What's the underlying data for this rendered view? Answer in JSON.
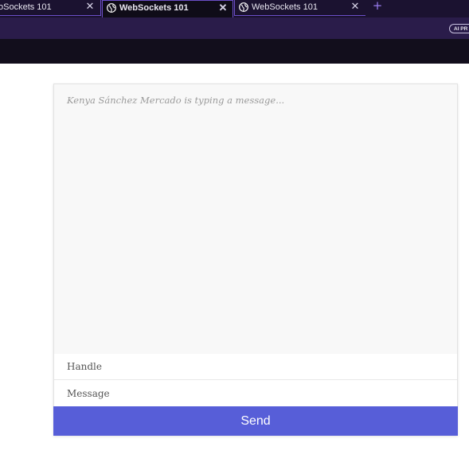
{
  "browser": {
    "tabs": [
      {
        "title": "oSockets 101",
        "close_icon": "close-icon"
      },
      {
        "title": "WebSockets 101",
        "icon": "globe-icon",
        "close_icon": "close-icon",
        "active": true
      },
      {
        "title": "WebSockets 101",
        "icon": "globe-icon",
        "close_icon": "close-icon"
      }
    ],
    "new_tab_label": "+",
    "ai_badge": "AI PR",
    "colors": {
      "tabbar": "#1b1230",
      "toolbar": "#2a1c4a",
      "accent": "#6c4fc8"
    }
  },
  "chat": {
    "feedback": "Kenya Sánchez Mercado is typing a message...",
    "handle_placeholder": "Handle",
    "message_placeholder": "Message",
    "send_label": "Send",
    "colors": {
      "send_button": "#575ed8",
      "chat_window": "#f8f8f8"
    }
  }
}
